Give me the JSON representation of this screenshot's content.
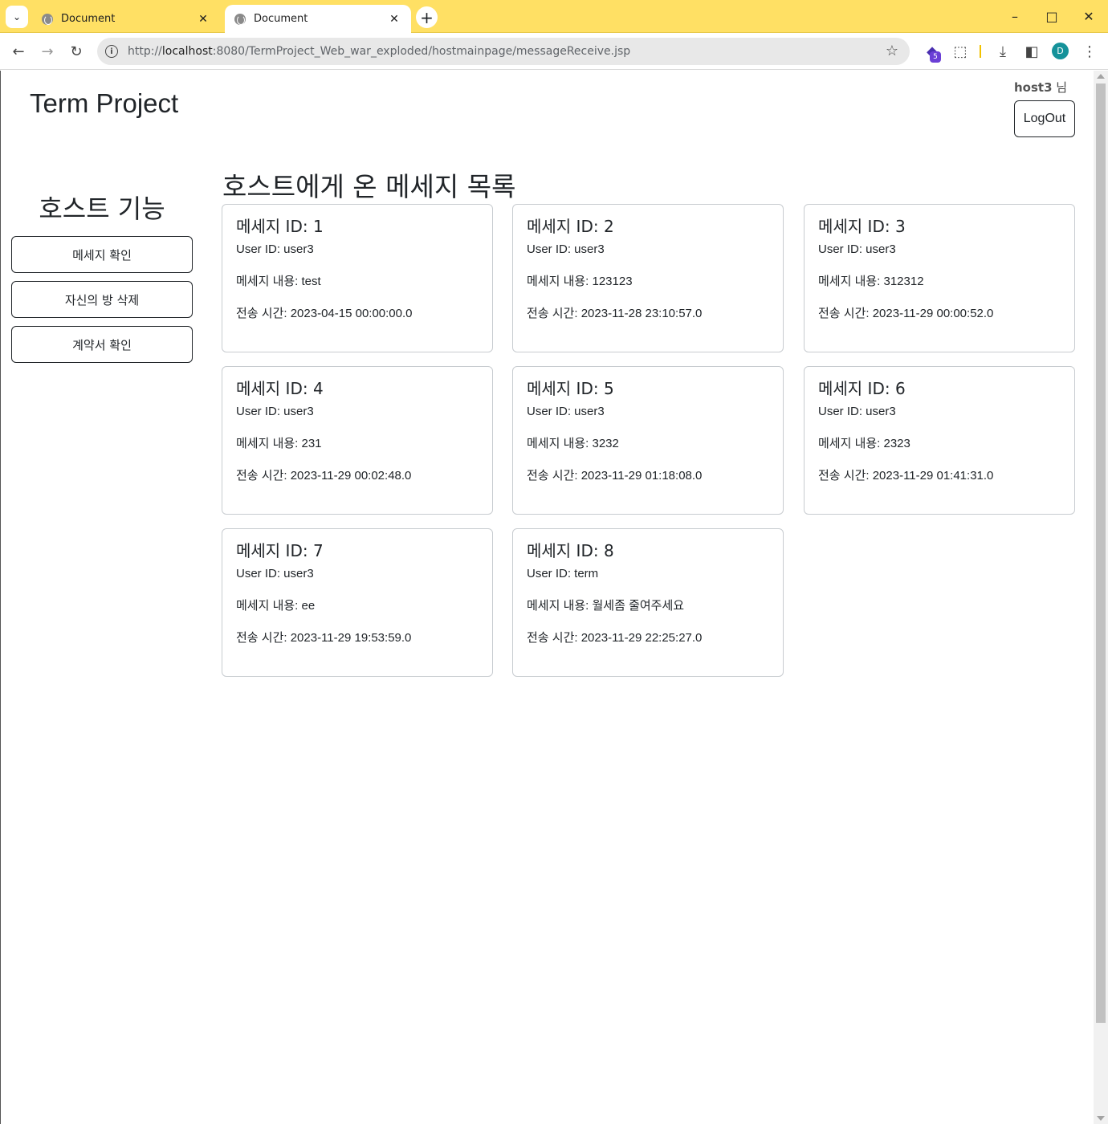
{
  "browser": {
    "tabs": [
      {
        "title": "Document",
        "active": false
      },
      {
        "title": "Document",
        "active": true
      }
    ],
    "url_prefix": "http://",
    "url_host": "localhost",
    "url_rest": ":8080/TermProject_Web_war_exploded/hostmainpage/messageReceive.jsp",
    "profile_initial": "D",
    "extension_badge": "5"
  },
  "header": {
    "brand": "Term Project",
    "username": "host3",
    "username_suffix": " 님",
    "logout_label": "LogOut"
  },
  "sidebar": {
    "title": "호스트 기능",
    "items": [
      {
        "label": "메세지 확인"
      },
      {
        "label": "자신의 방 삭제"
      },
      {
        "label": "계약서 확인"
      }
    ]
  },
  "main": {
    "title": "호스트에게 온 메세지 목록",
    "messages": [
      {
        "title": "메세지 ID: 1",
        "user": "User ID: user3",
        "content": "메세지 내용: test",
        "time": "전송 시간: 2023-04-15 00:00:00.0"
      },
      {
        "title": "메세지 ID: 2",
        "user": "User ID: user3",
        "content": "메세지 내용: 123123",
        "time": "전송 시간: 2023-11-28 23:10:57.0"
      },
      {
        "title": "메세지 ID: 3",
        "user": "User ID: user3",
        "content": "메세지 내용: 312312",
        "time": "전송 시간: 2023-11-29 00:00:52.0"
      },
      {
        "title": "메세지 ID: 4",
        "user": "User ID: user3",
        "content": "메세지 내용: 231",
        "time": "전송 시간: 2023-11-29 00:02:48.0"
      },
      {
        "title": "메세지 ID: 5",
        "user": "User ID: user3",
        "content": "메세지 내용: 3232",
        "time": "전송 시간: 2023-11-29 01:18:08.0"
      },
      {
        "title": "메세지 ID: 6",
        "user": "User ID: user3",
        "content": "메세지 내용: 2323",
        "time": "전송 시간: 2023-11-29 01:41:31.0"
      },
      {
        "title": "메세지 ID: 7",
        "user": "User ID: user3",
        "content": "메세지 내용: ee",
        "time": "전송 시간: 2023-11-29 19:53:59.0"
      },
      {
        "title": "메세지 ID: 8",
        "user": "User ID: term",
        "content": "메세지 내용: 월세좀 줄여주세요",
        "time": "전송 시간: 2023-11-29 22:25:27.0"
      }
    ]
  }
}
